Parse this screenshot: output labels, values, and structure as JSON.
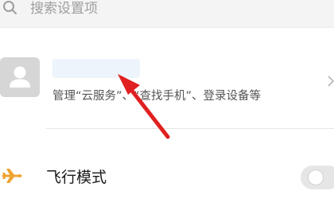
{
  "search": {
    "placeholder": "搜索设置项",
    "icon": "search-icon"
  },
  "account": {
    "description": "管理“云服务”、“查找手机”、登录设备等",
    "avatar_icon": "person-icon",
    "chevron_icon": "chevron-right-icon"
  },
  "settings": {
    "airplane_mode": {
      "label": "飞行模式",
      "icon": "airplane-icon",
      "enabled": false
    }
  },
  "colors": {
    "annotation_arrow": "#e02020",
    "icon_accent": "#f0a330",
    "avatar_bg": "#d6d6d6"
  }
}
